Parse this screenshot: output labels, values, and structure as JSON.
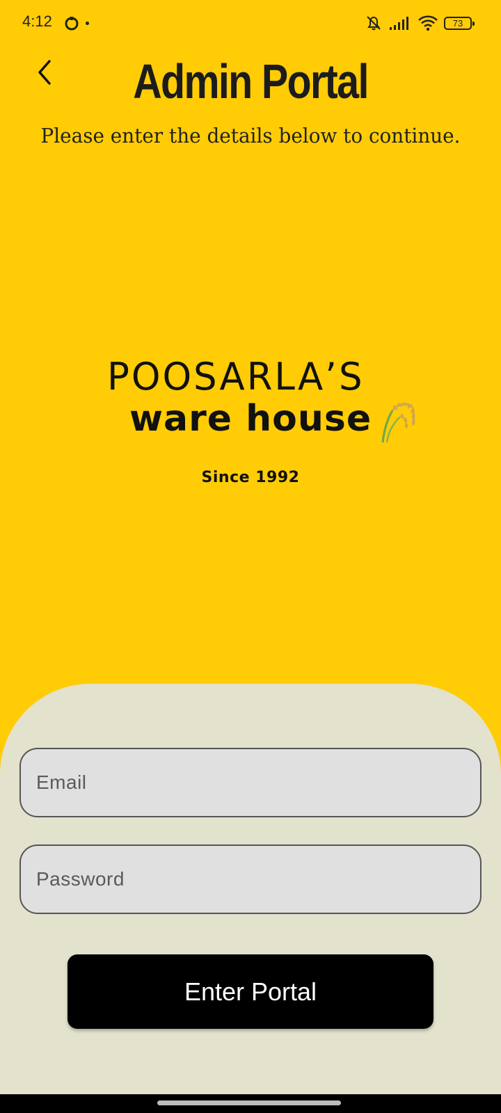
{
  "status_bar": {
    "time": "4:12",
    "battery": "73",
    "icons": [
      "app-notification-icon",
      "dot-icon",
      "bell-muted-icon",
      "signal-icon",
      "wifi-icon",
      "battery-icon"
    ]
  },
  "header": {
    "back_icon": "chevron-left-icon",
    "title": "Admin Portal",
    "subtitle": "Please enter the details below to continue."
  },
  "logo": {
    "line1": "POOSARLA’S",
    "line2": "ware house",
    "since": "Since 1992",
    "icon": "rice-grain-icon"
  },
  "form": {
    "email_placeholder": "Email",
    "password_placeholder": "Password",
    "submit_label": "Enter Portal"
  },
  "colors": {
    "background": "#FFCC06",
    "sheet": "#E3E2CD",
    "field": "#E0E0E0",
    "button": "#000000"
  }
}
